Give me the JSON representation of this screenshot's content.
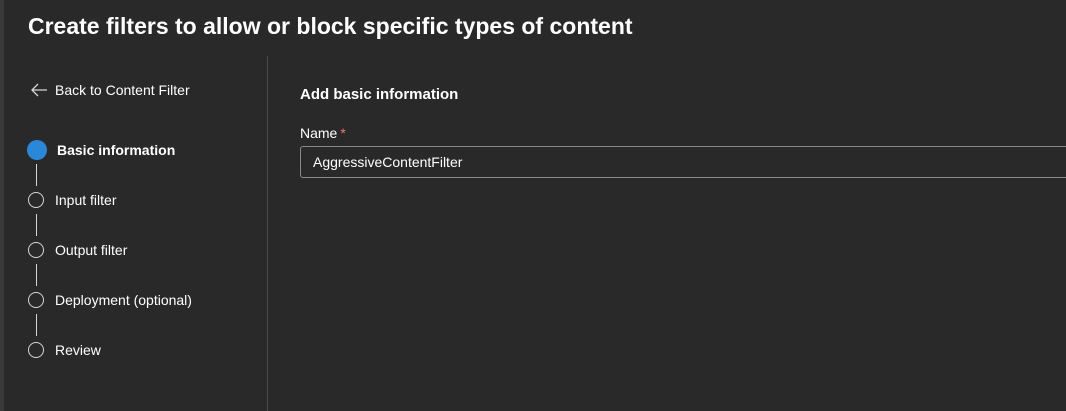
{
  "page": {
    "title": "Create filters to allow or block specific types of content"
  },
  "nav": {
    "back_label": "Back to Content Filter",
    "steps": [
      {
        "label": "Basic information",
        "active": true
      },
      {
        "label": "Input filter",
        "active": false
      },
      {
        "label": "Output filter",
        "active": false
      },
      {
        "label": "Deployment (optional)",
        "active": false
      },
      {
        "label": "Review",
        "active": false
      }
    ]
  },
  "form": {
    "section_title": "Add basic information",
    "name_label": "Name",
    "required_mark": "*",
    "name_value": "AggressiveContentFilter"
  },
  "icons": {
    "back": "arrow-left-icon"
  },
  "colors": {
    "background": "#292929",
    "accent": "#2b88d8",
    "required": "#f1707b",
    "step_ring": "#d6d6d6"
  }
}
